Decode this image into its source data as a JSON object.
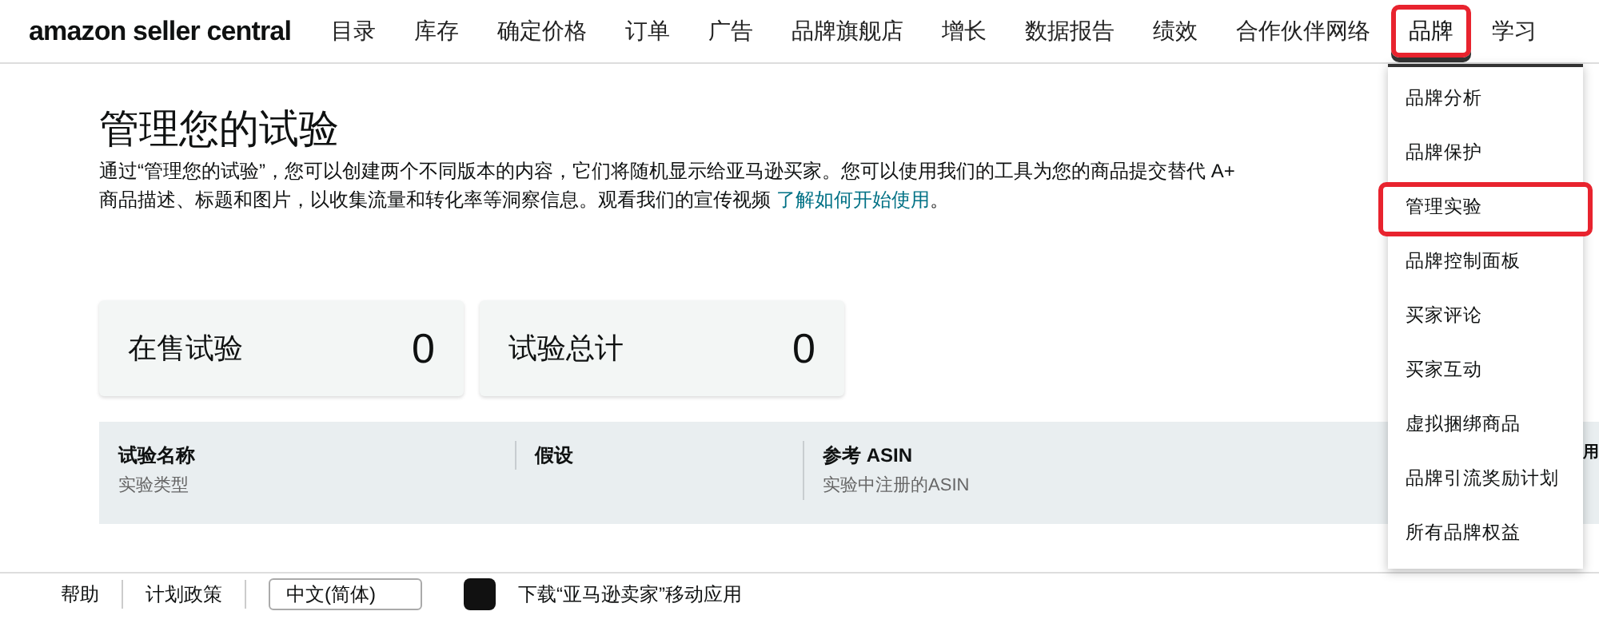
{
  "header": {
    "logo": "amazon seller central",
    "nav": [
      {
        "label": "目录",
        "selected": false,
        "highlighted": false
      },
      {
        "label": "库存",
        "selected": false,
        "highlighted": false
      },
      {
        "label": "确定价格",
        "selected": false,
        "highlighted": false
      },
      {
        "label": "订单",
        "selected": false,
        "highlighted": false
      },
      {
        "label": "广告",
        "selected": false,
        "highlighted": false
      },
      {
        "label": "品牌旗舰店",
        "selected": false,
        "highlighted": false
      },
      {
        "label": "增长",
        "selected": false,
        "highlighted": false
      },
      {
        "label": "数据报告",
        "selected": false,
        "highlighted": false
      },
      {
        "label": "绩效",
        "selected": false,
        "highlighted": false
      },
      {
        "label": "合作伙伴网络",
        "selected": false,
        "highlighted": false
      },
      {
        "label": "品牌",
        "selected": true,
        "highlighted": true
      },
      {
        "label": "学习",
        "selected": false,
        "highlighted": false
      }
    ]
  },
  "dropdown": {
    "items": [
      {
        "label": "品牌分析",
        "highlighted": false
      },
      {
        "label": "品牌保护",
        "highlighted": false
      },
      {
        "label": "管理实验",
        "highlighted": true
      },
      {
        "label": "品牌控制面板",
        "highlighted": false
      },
      {
        "label": "买家评论",
        "highlighted": false
      },
      {
        "label": "买家互动",
        "highlighted": false
      },
      {
        "label": "虚拟捆绑商品",
        "highlighted": false
      },
      {
        "label": "品牌引流奖励计划",
        "highlighted": false
      },
      {
        "label": "所有品牌权益",
        "highlighted": false
      }
    ]
  },
  "page": {
    "title": "管理您的试验",
    "description": "通过“管理您的试验”，您可以创建两个不同版本的内容，它们将随机显示给亚马逊买家。您可以使用我们的工具为您的商品提交替代 A+ 商品描述、标题和图片，以收集流量和转化率等洞察信息。观看我们的宣传视频 ",
    "link": "了解如何开始使用",
    "after_link": "。"
  },
  "stats": [
    {
      "label": "在售试验",
      "value": "0"
    },
    {
      "label": "试验总计",
      "value": "0"
    }
  ],
  "table": {
    "columns": [
      {
        "title": "试验名称",
        "subtitle": "实验类型"
      },
      {
        "title": "假设"
      },
      {
        "title": "参考 ASIN",
        "subtitle": "实验中注册的ASIN"
      },
      {
        "title": "用"
      }
    ]
  },
  "footer": {
    "links": [
      "帮助",
      "计划政策"
    ],
    "language": "中文(简体)",
    "app": "下载“亚马逊卖家”移动应用"
  }
}
